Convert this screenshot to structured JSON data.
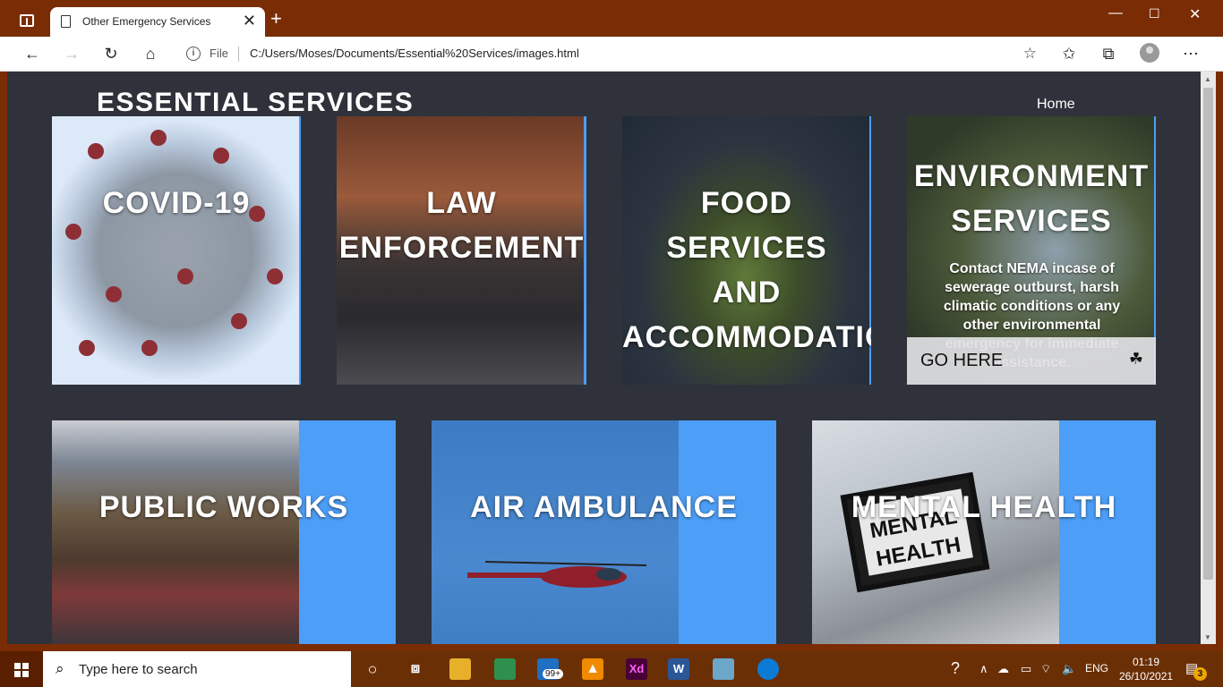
{
  "browser": {
    "tab_title": "Other Emergency Services",
    "file_label": "File",
    "url": "C:/Users/Moses/Documents/Essential%20Services/images.html"
  },
  "page": {
    "site_title": "ESSENTIAL SERVICES",
    "nav_home": "Home",
    "cards_row1": [
      {
        "label": "COVID-19"
      },
      {
        "label": "LAW\nENFORCEMENT"
      },
      {
        "label": "FOOD\nSERVICES\nAND\nACCOMMODATION"
      },
      {
        "label": "ENVIRONMENT\nSERVICES"
      }
    ],
    "env_description": "Contact NEMA incase of sewerage outburst, harsh climatic conditions or any other environmental emergency for immediate assistance.",
    "go_button": "GO HERE",
    "cards_row2": [
      {
        "label": "PUBLIC WORKS"
      },
      {
        "label": "AIR AMBULANCE"
      },
      {
        "label": "MENTAL HEALTH"
      }
    ],
    "mental_sign_text": "MENTAL\nHEALTH"
  },
  "taskbar": {
    "search_placeholder": "Type here to search",
    "mail_badge": "99+",
    "xd_label": "Xd",
    "word_label": "W",
    "language": "ENG",
    "time": "01:19",
    "date": "26/10/2021",
    "notifications": "3"
  },
  "colors": {
    "page_bg": "#2f323a",
    "accent_blue": "#4d9ef7",
    "chrome": "#7a2c05"
  }
}
